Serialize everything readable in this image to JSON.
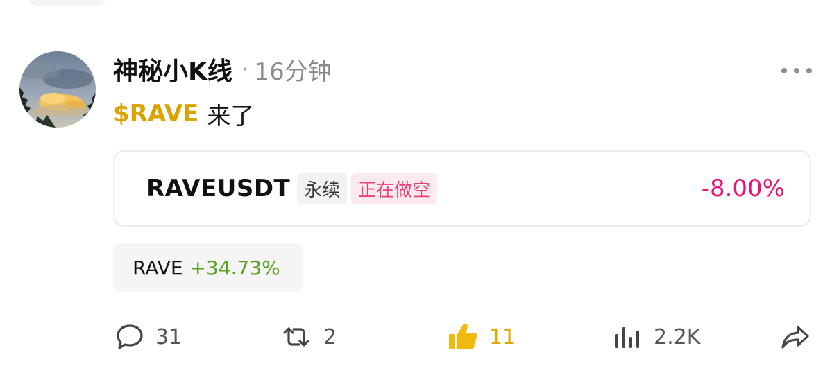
{
  "post": {
    "author": "神秘小K线",
    "separator": "·",
    "time": "16分钟",
    "cashtag": "$RAVE",
    "body": "来了"
  },
  "trade_card": {
    "symbol": "RAVEUSDT",
    "contract_tag": "永续",
    "position_tag": "正在做空",
    "change": "-8.00%"
  },
  "price_chip": {
    "symbol": "RAVE",
    "change": "+34.73%"
  },
  "actions": {
    "comments": "31",
    "reposts": "2",
    "likes": "11",
    "views": "2.2K"
  },
  "icons": {
    "more": "more-horizontal-icon",
    "comment": "comment-icon",
    "repost": "repost-icon",
    "like": "thumbs-up-icon",
    "views": "bar-chart-icon",
    "share": "share-icon"
  },
  "colors": {
    "cashtag": "#d9a400",
    "negative": "#e8137a",
    "positive": "#5aa01f",
    "liked": "#f0b90b",
    "short_tag_bg": "#fdeaef"
  }
}
